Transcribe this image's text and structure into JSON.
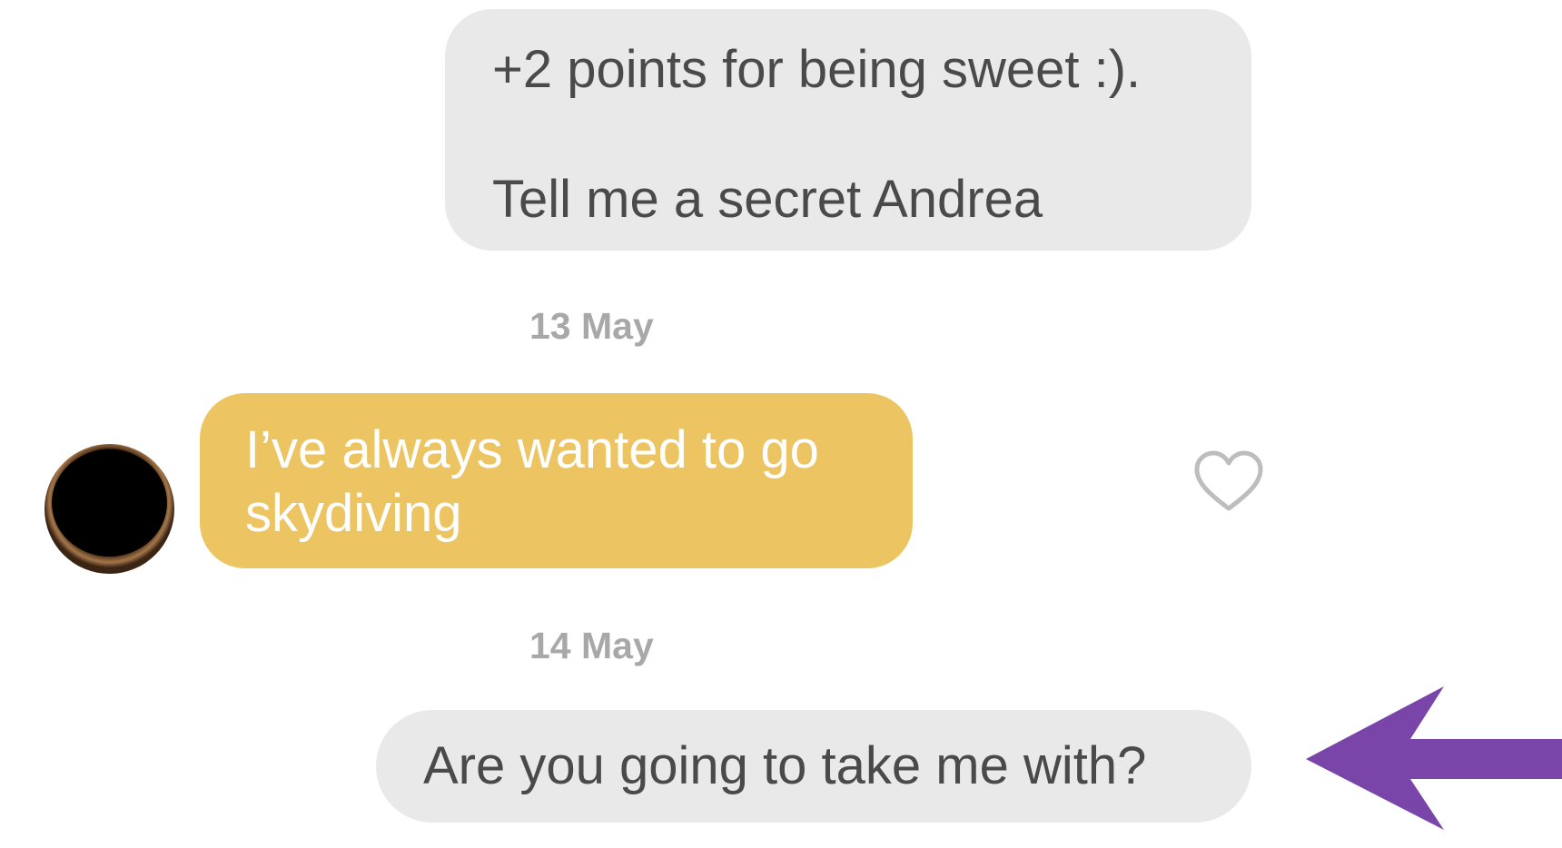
{
  "messages": [
    {
      "direction": "outgoing",
      "lines": [
        "+2 points for being sweet :).",
        "Tell me a secret Andrea"
      ]
    },
    {
      "direction": "incoming",
      "text": "I’ve always wanted to go skydiving"
    },
    {
      "direction": "outgoing",
      "text": "Are you going to take me with?"
    }
  ],
  "dates": [
    "13 May",
    "14 May"
  ],
  "icons": {
    "like": "heart-icon",
    "pointer": "arrow-left-icon"
  },
  "colors": {
    "outgoing_bubble": "#e9e9e9",
    "outgoing_text": "#4a4a4a",
    "incoming_bubble": "#ecc462",
    "incoming_text": "#ffffff",
    "date_text": "#a8a8a8",
    "arrow": "#7a45a8",
    "heart_outline": "#bdbdbd"
  }
}
